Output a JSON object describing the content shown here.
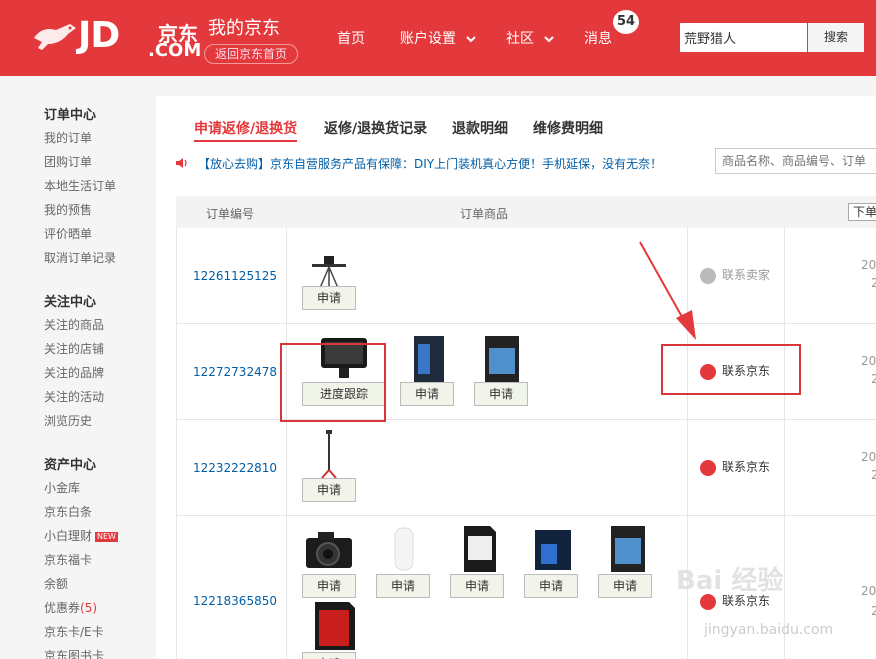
{
  "header": {
    "logo_text": "JD",
    "logo_cn": "京东",
    "logo_com": ".COM",
    "title": "我的京东",
    "back_home": "返回京东首页",
    "nav": [
      {
        "label": "首页"
      },
      {
        "label": "账户设置"
      },
      {
        "label": "社区"
      },
      {
        "label": "消息"
      }
    ],
    "message_count": "54",
    "search_value": "荒野猎人",
    "search_button": "搜索",
    "brand_color": "#e4393c"
  },
  "sidebar": {
    "groups": [
      {
        "title": "订单中心",
        "items": [
          "我的订单",
          "团购订单",
          "本地生活订单",
          "我的预售",
          "评价晒单",
          "取消订单记录"
        ]
      },
      {
        "title": "关注中心",
        "items": [
          "关注的商品",
          "关注的店铺",
          "关注的品牌",
          "关注的活动",
          "浏览历史"
        ]
      },
      {
        "title": "资产中心",
        "items": [
          "小金库",
          "京东白条",
          "小白理财",
          "京东福卡",
          "余额",
          "优惠券",
          "京东卡/E卡",
          "京东图书卡"
        ]
      }
    ],
    "new_badge": "NEW",
    "coupon_count": "(5)"
  },
  "main": {
    "tabs": [
      "申请返修/退换货",
      "返修/退换货记录",
      "退款明细",
      "维修费明细"
    ],
    "notice_prefix": "【放心去购】",
    "notice_text": "京东自营服务产品有保障：DIY上门装机真心方便！手机延保，没有无奈！",
    "search_placeholder": "商品名称、商品编号、订单",
    "columns": [
      "订单编号",
      "订单商品"
    ],
    "dropdown": "下单",
    "rows": [
      {
        "order_no": "12261125125",
        "contact": "联系卖家",
        "date_top": "20",
        "date_bottom": "2"
      },
      {
        "order_no": "12272732478",
        "contact": "联系京东",
        "date_top": "20",
        "date_bottom": "2"
      },
      {
        "order_no": "12232222810",
        "contact": "联系京东",
        "date_top": "20",
        "date_bottom": "2"
      },
      {
        "order_no": "12218365850",
        "contact": "联系京东",
        "date_top": "20",
        "date_bottom": "2"
      }
    ],
    "apply_label": "申请",
    "track_label": "进度跟踪"
  },
  "watermark": {
    "text": "Bai 经验",
    "url": "jingyan.baidu.com"
  }
}
